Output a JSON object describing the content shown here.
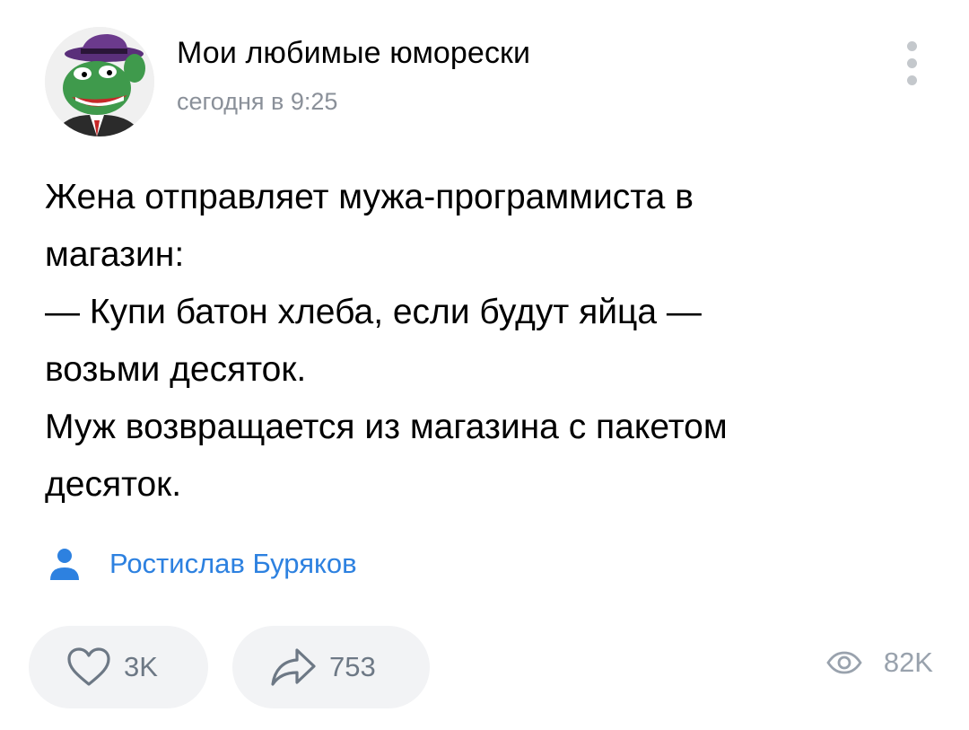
{
  "post": {
    "group_name": "Мои любимые юморески",
    "time": "сегодня в 9:25",
    "text_lines": [
      "Жена отправляет мужа-программиста в",
      "магазин:",
      "— Купи батон хлеба, если будут яйца —",
      "возьми десяток.",
      "Муж возвращается из магазина с пакетом",
      "десяток."
    ],
    "author": "Ростислав Буряков",
    "likes": "3K",
    "shares": "753",
    "views": "82K"
  },
  "icons": {
    "avatar": "frog-in-hat-avatar",
    "more": "more-vertical-icon",
    "author": "person-icon",
    "like": "heart-icon",
    "share": "share-arrow-icon",
    "views": "eye-icon"
  },
  "colors": {
    "link": "#2d81e0",
    "secondary_text": "#8a9099",
    "counter_text": "#6d7885",
    "pill_bg": "#f2f3f5",
    "icon_gray": "#99a2ad"
  }
}
